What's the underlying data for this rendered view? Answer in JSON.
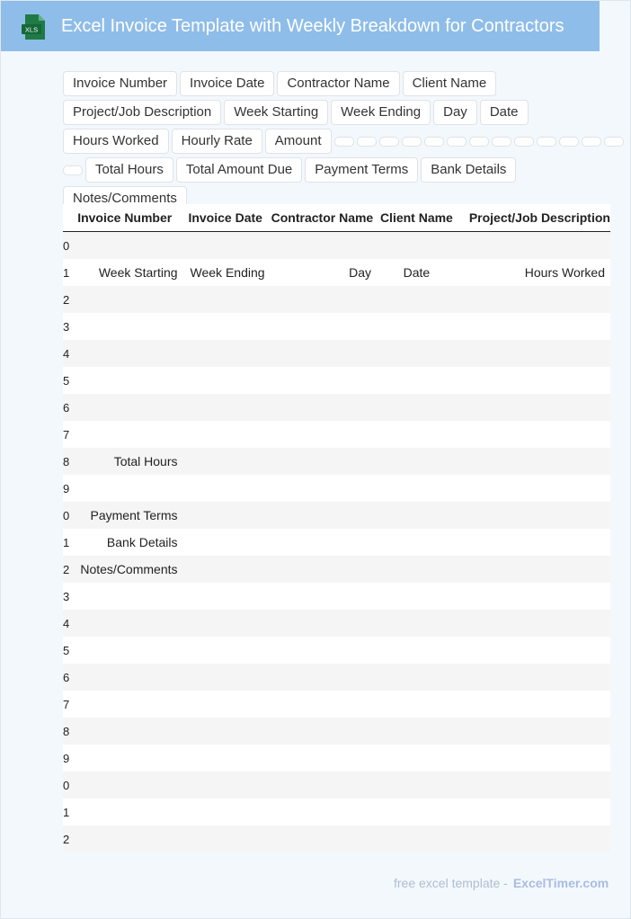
{
  "header": {
    "title": "Excel Invoice Template with Weekly Breakdown for Contractors",
    "icon_label": "XLS",
    "icon": "excel-file-icon",
    "background": "#8fbde9",
    "icon_color": "#1f7a46"
  },
  "tags": [
    "Invoice Number",
    "Invoice Date",
    "Contractor Name",
    "Client Name",
    "Project/Job Description",
    "Week Starting",
    "Week Ending",
    "Day",
    "Date",
    "Hours Worked",
    "Hourly Rate",
    "Amount",
    "",
    "",
    "",
    "",
    "",
    "",
    "",
    "",
    "",
    "",
    "",
    "",
    "",
    "",
    "Total Hours",
    "Total Amount Due",
    "Payment Terms",
    "Bank Details",
    "Notes/Comments"
  ],
  "sheet": {
    "columns": [
      "Invoice Number",
      "Invoice Date",
      "Contractor Name",
      "Client Name",
      "Project/Job Description"
    ],
    "rows": [
      {
        "n": "0",
        "cells": [
          "",
          "",
          "",
          "",
          ""
        ]
      },
      {
        "n": "1",
        "cells": [
          "Week Starting",
          "Week Ending",
          "Day",
          "Date",
          "Hours Worked"
        ]
      },
      {
        "n": "2",
        "cells": [
          "",
          "",
          "",
          "",
          ""
        ]
      },
      {
        "n": "3",
        "cells": [
          "",
          "",
          "",
          "",
          ""
        ]
      },
      {
        "n": "4",
        "cells": [
          "",
          "",
          "",
          "",
          ""
        ]
      },
      {
        "n": "5",
        "cells": [
          "",
          "",
          "",
          "",
          ""
        ]
      },
      {
        "n": "6",
        "cells": [
          "",
          "",
          "",
          "",
          ""
        ]
      },
      {
        "n": "7",
        "cells": [
          "",
          "",
          "",
          "",
          ""
        ]
      },
      {
        "n": "8",
        "cells": [
          "Total Hours",
          "",
          "",
          "",
          ""
        ]
      },
      {
        "n": "9",
        "cells": [
          "",
          "",
          "",
          "",
          ""
        ]
      },
      {
        "n": "0",
        "cells": [
          "Payment Terms",
          "",
          "",
          "",
          ""
        ]
      },
      {
        "n": "1",
        "cells": [
          "Bank Details",
          "",
          "",
          "",
          ""
        ]
      },
      {
        "n": "2",
        "cells": [
          "Notes/Comments",
          "",
          "",
          "",
          ""
        ]
      },
      {
        "n": "3",
        "cells": [
          "",
          "",
          "",
          "",
          ""
        ]
      },
      {
        "n": "4",
        "cells": [
          "",
          "",
          "",
          "",
          ""
        ]
      },
      {
        "n": "5",
        "cells": [
          "",
          "",
          "",
          "",
          ""
        ]
      },
      {
        "n": "6",
        "cells": [
          "",
          "",
          "",
          "",
          ""
        ]
      },
      {
        "n": "7",
        "cells": [
          "",
          "",
          "",
          "",
          ""
        ]
      },
      {
        "n": "8",
        "cells": [
          "",
          "",
          "",
          "",
          ""
        ]
      },
      {
        "n": "9",
        "cells": [
          "",
          "",
          "",
          "",
          ""
        ]
      },
      {
        "n": "0",
        "cells": [
          "",
          "",
          "",
          "",
          ""
        ]
      },
      {
        "n": "1",
        "cells": [
          "",
          "",
          "",
          "",
          ""
        ]
      },
      {
        "n": "2",
        "cells": [
          "",
          "",
          "",
          "",
          ""
        ]
      }
    ]
  },
  "footer": {
    "text": "free excel template -",
    "brand": "ExcelTimer.com"
  }
}
